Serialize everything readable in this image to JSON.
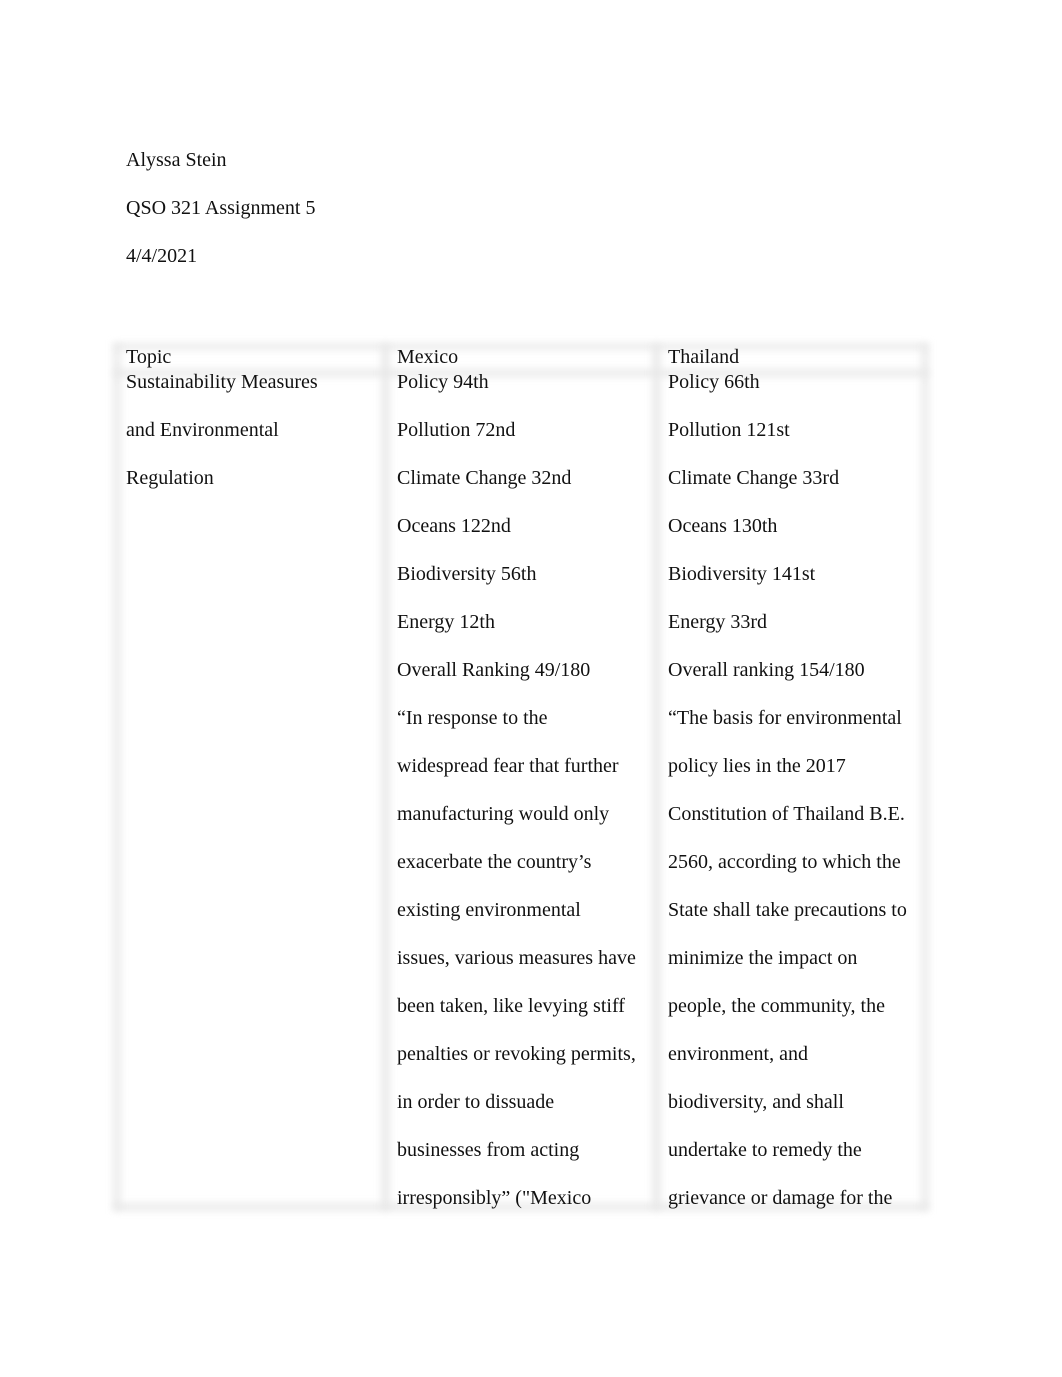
{
  "document": {
    "header": {
      "author": "Alyssa Stein",
      "course": "QSO 321 Assignment 5",
      "date": "4/4/2021"
    },
    "table": {
      "columns": [
        "Topic",
        "Mexico",
        "Thailand"
      ],
      "rows": [
        {
          "topic_lines": [
            "Sustainability Measures",
            "and Environmental",
            "Regulation"
          ],
          "mexico_lines": [
            "Policy 94th",
            "Pollution 72nd",
            "Climate Change 32nd",
            "Oceans 122nd",
            "Biodiversity 56th",
            "Energy 12th",
            "Overall Ranking 49/180",
            "“In response to the",
            "widespread fear that further",
            "manufacturing would only",
            "exacerbate the country’s",
            "existing environmental",
            "issues, various measures have",
            "been taken, like levying stiff",
            "penalties or revoking permits,",
            "in order to dissuade",
            "businesses from acting",
            "irresponsibly” (\"Mexico"
          ],
          "thailand_lines": [
            "Policy 66th",
            "Pollution 121st",
            "Climate Change 33rd",
            "Oceans 130th",
            "Biodiversity 141st",
            "Energy 33rd",
            "Overall ranking 154/180",
            "“The basis for environmental",
            "policy lies in the 2017",
            "Constitution of Thailand B.E.",
            "2560, according to which the",
            "State shall take precautions to",
            "minimize the impact on",
            "people, the community, the",
            "environment, and",
            "biodiversity, and shall",
            "undertake to remedy the",
            "grievance or damage for the"
          ]
        }
      ]
    }
  }
}
